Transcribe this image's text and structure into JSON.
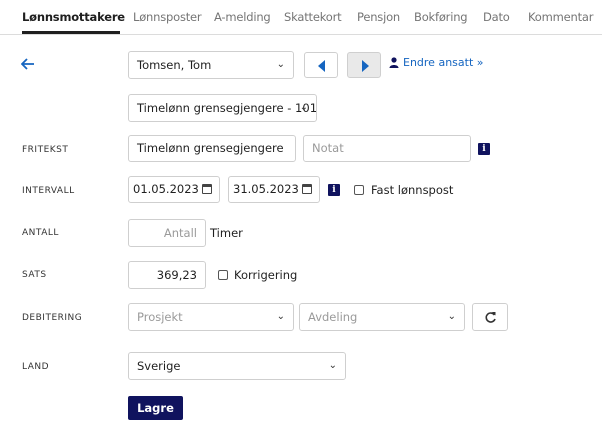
{
  "tabs": [
    {
      "label": "Lønnsmottakere"
    },
    {
      "label": "Lønnsposter"
    },
    {
      "label": "A-melding"
    },
    {
      "label": "Skattekort"
    },
    {
      "label": "Pensjon"
    },
    {
      "label": "Bokføring"
    },
    {
      "label": "Dato"
    },
    {
      "label": "Kommentar"
    }
  ],
  "header": {
    "back_icon": "arrow-left",
    "employee_selected": "Tomsen, Tom",
    "prev_icon": "triangle-left",
    "next_icon": "triangle-right",
    "edit_employee_label": "Endre ansatt »",
    "edit_icon": "person"
  },
  "form": {
    "wage_type_selected": "Timelønn grensegjengere - 101",
    "fritekst": {
      "label": "FRITEKST",
      "value": "Timelønn grensegjengere",
      "notat_placeholder": "Notat"
    },
    "intervall": {
      "label": "INTERVALL",
      "from": "01.05.2023",
      "to": "31.05.2023",
      "fast_label": "Fast lønnspost",
      "fast_checked": false
    },
    "antall": {
      "label": "ANTALL",
      "placeholder": "Antall",
      "unit": "Timer"
    },
    "sats": {
      "label": "SATS",
      "value": "369,23",
      "korrigering_label": "Korrigering",
      "korrigering_checked": false
    },
    "debitering": {
      "label": "DEBITERING",
      "prosjekt_placeholder": "Prosjekt",
      "avdeling_placeholder": "Avdeling",
      "refresh_icon": "refresh"
    },
    "land": {
      "label": "LAND",
      "selected": "Sverige"
    },
    "save_label": "Lagre"
  },
  "colors": {
    "primary": "#10135e",
    "accent_blue": "#1565c0",
    "border": "#cfcfcf"
  }
}
